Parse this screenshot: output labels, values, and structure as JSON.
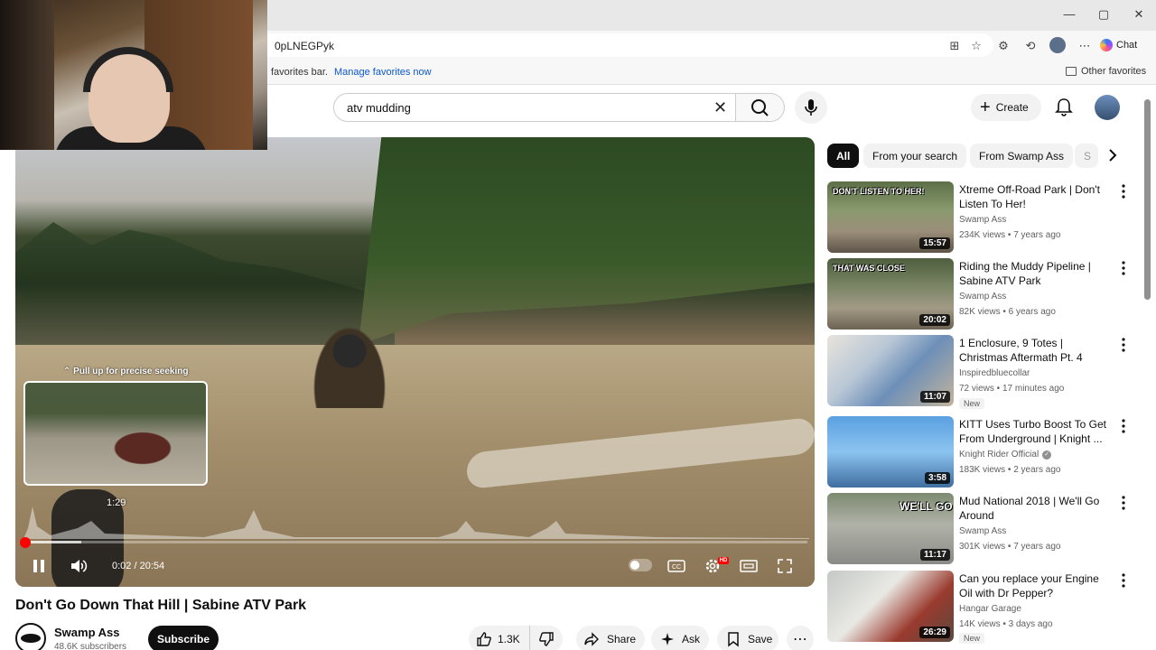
{
  "browser": {
    "url_fragment": "0pLNEGPyk",
    "favorites_text": "favorites bar.",
    "manage_favorites": "Manage favorites now",
    "other_favorites": "Other favorites",
    "chat_label": "Chat"
  },
  "search": {
    "query": "atv mudding"
  },
  "header": {
    "create_label": "Create"
  },
  "player": {
    "seek_hint": "Pull up for precise seeking",
    "preview_time": "1:29",
    "time_display": "0:02 / 20:54",
    "progress_fraction": 0.0016,
    "hd_badge": "HD"
  },
  "video": {
    "title": "Don't Go Down That Hill | Sabine ATV Park",
    "channel": "Swamp Ass",
    "subscribers": "48.6K subscribers",
    "subscribe_label": "Subscribe",
    "likes": "1.3K",
    "share_label": "Share",
    "ask_label": "Ask",
    "save_label": "Save"
  },
  "chips": [
    "All",
    "From your search",
    "From Swamp Ass",
    "S"
  ],
  "recommendations": [
    {
      "title": "Xtreme Off-Road Park | Don't Listen To Her!",
      "channel": "Swamp Ass",
      "meta": "234K views • 7 years ago",
      "duration": "15:57",
      "overlay": "DON'T LISTEN TO HER!",
      "verified": false,
      "badge": ""
    },
    {
      "title": "Riding the Muddy Pipeline | Sabine ATV Park",
      "channel": "Swamp Ass",
      "meta": "82K views • 6 years ago",
      "duration": "20:02",
      "overlay": "THAT WAS CLOSE",
      "verified": false,
      "badge": ""
    },
    {
      "title": "1 Enclosure, 9 Totes | Christmas Aftermath Pt. 4",
      "channel": "Inspiredbluecollar",
      "meta": "72 views • 17 minutes ago",
      "duration": "11:07",
      "overlay": "",
      "verified": false,
      "badge": "New"
    },
    {
      "title": "KITT Uses Turbo Boost To Get From Underground | Knight ...",
      "channel": "Knight Rider Official",
      "meta": "183K views • 2 years ago",
      "duration": "3:58",
      "overlay": "",
      "verified": true,
      "badge": ""
    },
    {
      "title": "Mud National 2018 | We'll Go Around",
      "channel": "Swamp Ass",
      "meta": "301K views • 7 years ago",
      "duration": "11:17",
      "overlay": "WE'LL GO",
      "verified": false,
      "badge": ""
    },
    {
      "title": "Can you replace your Engine Oil with Dr Pepper?",
      "channel": "Hangar Garage",
      "meta": "14K views • 3 days ago",
      "duration": "26:29",
      "overlay": "",
      "verified": false,
      "badge": "New"
    }
  ],
  "colors": {
    "accent_red": "#ff0000",
    "text_primary": "#0f0f0f",
    "text_secondary": "#606060",
    "chip_bg": "#f2f2f2"
  }
}
